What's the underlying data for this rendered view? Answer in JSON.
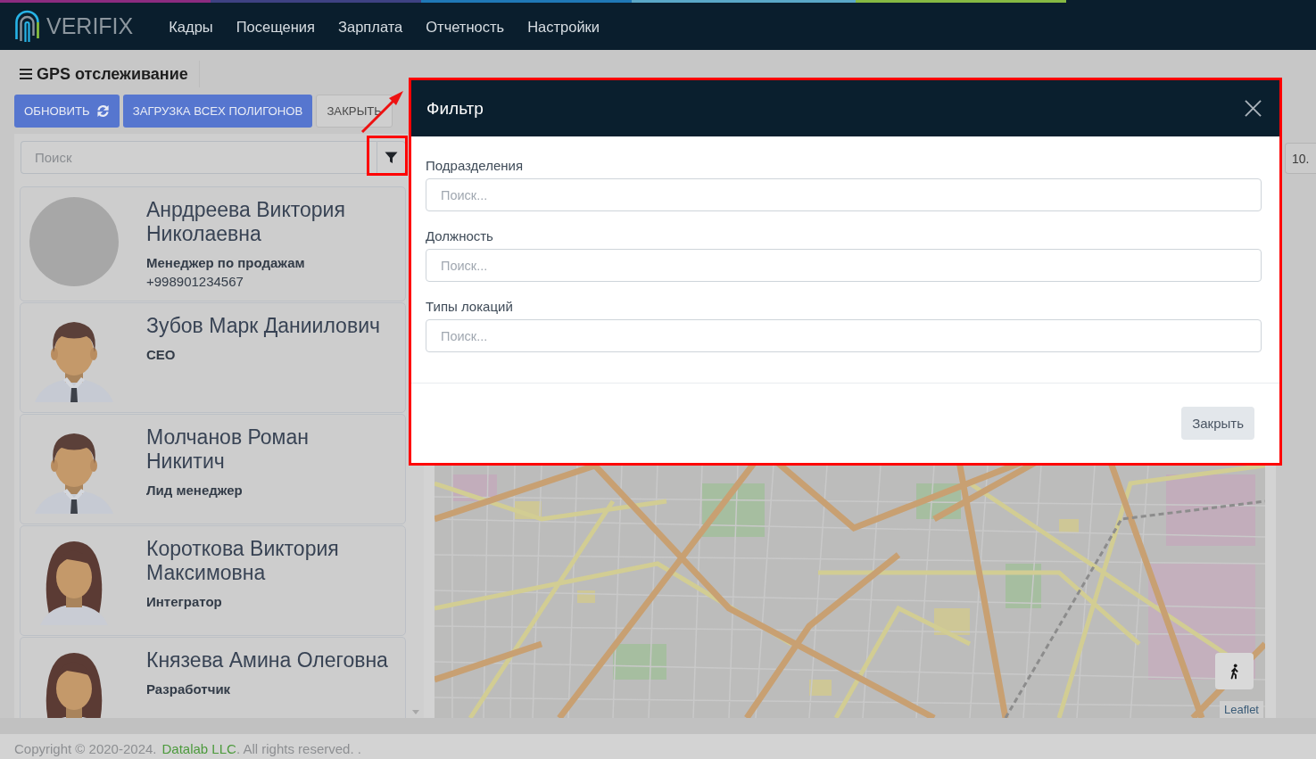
{
  "navbar": {
    "logo": "VERIFIX",
    "menu": [
      {
        "label": "Кадры"
      },
      {
        "label": "Посещения"
      },
      {
        "label": "Зарплата"
      },
      {
        "label": "Отчетность"
      },
      {
        "label": "Настройки"
      }
    ]
  },
  "page_title": "GPS отслеживание",
  "toolbar": [
    {
      "label": "ОБНОВИТЬ",
      "kind": "refresh"
    },
    {
      "label": "ЗАГРУЗКА ВСЕХ ПОЛИГОНОВ",
      "kind": "primary"
    },
    {
      "label": "ЗАКРЫТЬ",
      "kind": "secondary"
    }
  ],
  "search": {
    "placeholder": "Поиск",
    "filter_highlighted": true
  },
  "employees": [
    {
      "kind": "photo",
      "name": "Анрдреева Виктория Николаевна",
      "position": "Менеджер по продажам",
      "phone": "+998901234567"
    },
    {
      "kind": "man",
      "name": "Зубов Марк Даниилович",
      "position": "CEO"
    },
    {
      "kind": "man",
      "name": "Молчанов Роман Никитич",
      "position": "Лид менеджер"
    },
    {
      "kind": "woman",
      "name": "Короткова Виктория Максимовна",
      "position": "Интегратор"
    },
    {
      "kind": "woman",
      "name": "Князева Амина Олеговна",
      "position": "Разработчик"
    }
  ],
  "map": {
    "attribution": "Leaflet"
  },
  "right_panel": {
    "buttons": [
      "10."
    ]
  },
  "footer": {
    "text_before": "Copyright © 2020-2024.",
    "link": "Datalab LLC",
    "text_after": ". All rights reserved. ."
  },
  "dialog": {
    "title": "Фильтр",
    "highlighted": true,
    "fields": [
      {
        "label": "Подразделения",
        "placeholder": "Поиск..."
      },
      {
        "label": "Должность",
        "placeholder": "Поиск..."
      },
      {
        "label": "Типы локаций",
        "placeholder": "Поиск..."
      }
    ],
    "buttons": [
      "Закрыть"
    ]
  },
  "annotations": [
    {
      "kind": "arrow"
    }
  ]
}
